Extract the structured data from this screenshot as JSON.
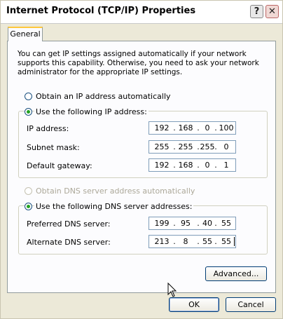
{
  "window": {
    "title": "Internet Protocol (TCP/IP) Properties",
    "help_glyph": "?",
    "close_glyph": "✕"
  },
  "tabs": [
    {
      "label": "General",
      "selected": true
    }
  ],
  "intro_text": "You can get IP settings assigned automatically if your network supports this capability. Otherwise, you need to ask your network administrator for the appropriate IP settings.",
  "ip_section": {
    "auto_label": "Obtain an IP address automatically",
    "auto_selected": false,
    "manual_label": "Use the following IP address:",
    "manual_selected": true,
    "fields": [
      {
        "label": "IP address:",
        "octets": [
          "192",
          "168",
          "0",
          "100"
        ]
      },
      {
        "label": "Subnet mask:",
        "octets": [
          "255",
          "255",
          "255",
          "0"
        ]
      },
      {
        "label": "Default gateway:",
        "octets": [
          "192",
          "168",
          "0",
          "1"
        ]
      }
    ]
  },
  "dns_section": {
    "auto_label": "Obtain DNS server address automatically",
    "auto_disabled": true,
    "manual_label": "Use the following DNS server addresses:",
    "manual_selected": true,
    "fields": [
      {
        "label": "Preferred DNS server:",
        "octets": [
          "199",
          "95",
          "40",
          "55"
        ]
      },
      {
        "label": "Alternate DNS server:",
        "octets": [
          "213",
          "8",
          "55",
          "55"
        ]
      }
    ]
  },
  "buttons": {
    "advanced": "Advanced...",
    "ok": "OK",
    "cancel": "Cancel"
  },
  "colors": {
    "dialog_bg": "#ece9d8",
    "tab_accent": "#ffc83c",
    "radio_dot": "#21a121",
    "field_border": "#7f9db9",
    "button_border": "#003c74"
  }
}
